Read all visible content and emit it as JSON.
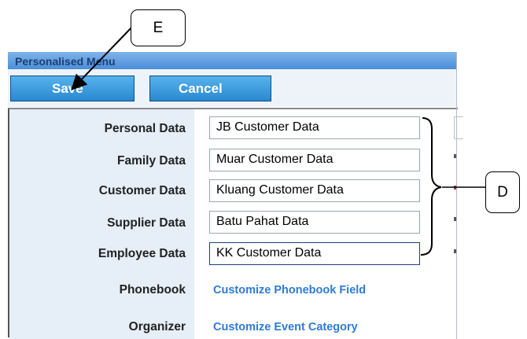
{
  "callouts": {
    "e": "E",
    "d": "D"
  },
  "menu": {
    "title": "Personalised Menu"
  },
  "toolbar": {
    "save_label": "Save",
    "cancel_label": "Cancel"
  },
  "rows": [
    {
      "label": "Personal Data",
      "value": "JB Customer Data"
    },
    {
      "label": "Family Data",
      "value": "Muar Customer Data"
    },
    {
      "label": "Customer Data",
      "value": "Kluang Customer Data"
    },
    {
      "label": "Supplier Data",
      "value": "Batu Pahat  Data"
    },
    {
      "label": "Employee Data",
      "value": "KK Customer Data"
    }
  ],
  "links": [
    {
      "label": "Phonebook",
      "text": "Customize Phonebook Field"
    },
    {
      "label": "Organizer",
      "text": "Customize Event Category"
    }
  ]
}
